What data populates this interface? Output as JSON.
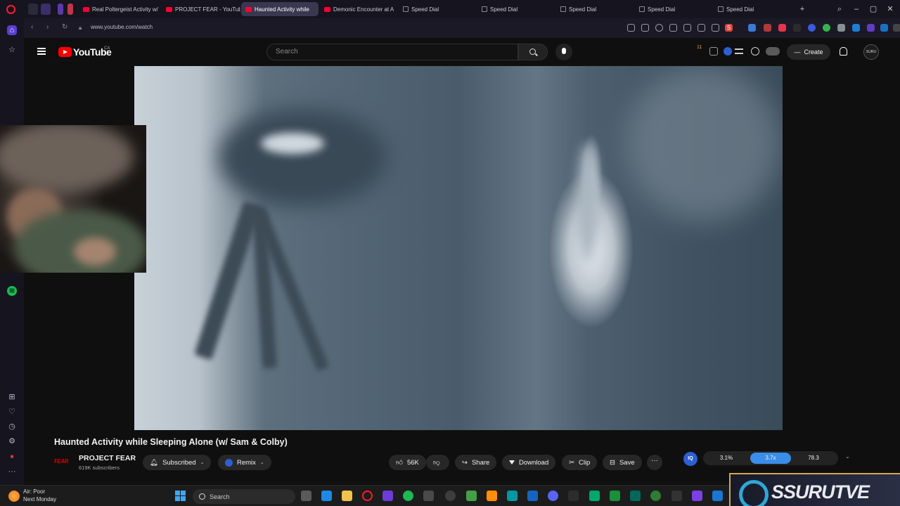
{
  "browser": {
    "tabs": [
      {
        "label": "Real Poltergeist Activity w/",
        "active": false
      },
      {
        "label": "PROJECT FEAR - YouTube",
        "active": false
      },
      {
        "label": "Haunted Activity while",
        "active": true
      },
      {
        "label": "Demonic Encounter at A",
        "active": false
      },
      {
        "label": "Speed Dial",
        "active": false
      },
      {
        "label": "Speed Dial",
        "active": false
      },
      {
        "label": "Speed Dial",
        "active": false
      },
      {
        "label": "Speed Dial",
        "active": false
      },
      {
        "label": "Speed Dial",
        "active": false
      }
    ],
    "url": "www.youtube.com/watch",
    "extension_badge": "S"
  },
  "youtube": {
    "logo_text": "YouTube",
    "country_code": "CA",
    "search_placeholder": "Search",
    "notification_count": "11",
    "create_label": "Create",
    "avatar_text": "SURU"
  },
  "video": {
    "title": "Haunted Activity while Sleeping Alone (w/ Sam & Colby)",
    "channel": {
      "logo_text": "FEAR",
      "name": "PROJECT FEAR",
      "subscribers": "619K subscribers"
    },
    "subscribed_label": "Subscribed",
    "remix_label": "Remix",
    "like_count": "56K",
    "share_label": "Share",
    "download_label": "Download",
    "clip_label": "Clip",
    "save_label": "Save",
    "more_label": "···"
  },
  "extension_panel": {
    "badge": "IQ",
    "stats": [
      {
        "value": "3.1%",
        "active": false
      },
      {
        "value": "3.7x",
        "active": true
      },
      {
        "value": "78.3",
        "active": false
      }
    ]
  },
  "stream_overlay": {
    "brand": "SSURUTVE"
  },
  "taskbar": {
    "weather_line1": "Air: Poor",
    "weather_line2": "Next Monday",
    "search_label": "Search"
  },
  "colors": {
    "youtube_red": "#ff0000",
    "stat_active": "#3a8de8",
    "browser_bg": "#16141f"
  }
}
